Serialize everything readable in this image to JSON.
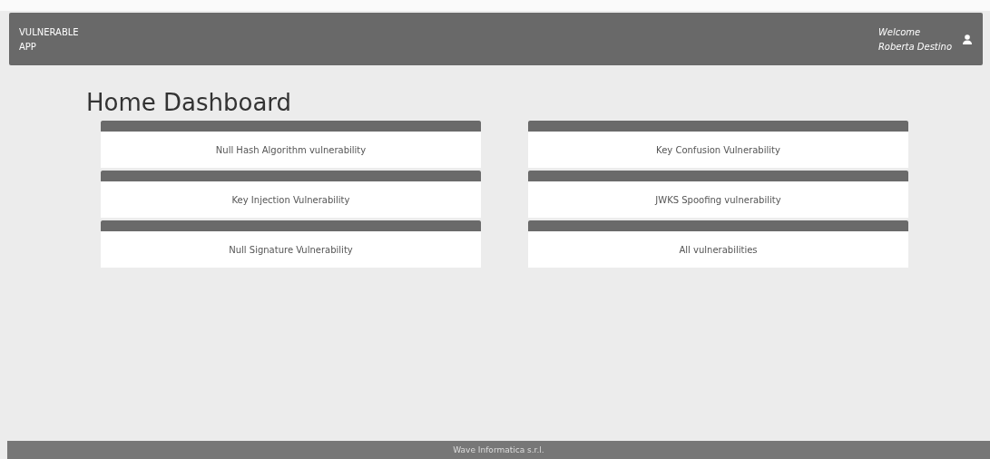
{
  "navbar": {
    "brand": [
      "VULNERABLE",
      "APP"
    ],
    "welcome": "Welcome",
    "user": "Roberta Destino"
  },
  "page_title": "Home Dashboard",
  "cards": [
    {
      "label": "Null Hash Algorithm vulnerability"
    },
    {
      "label": "Key Confusion Vulnerability"
    },
    {
      "label": "Key Injection Vulnerability"
    },
    {
      "label": "JWKS Spoofing vulnerability"
    },
    {
      "label": "Null Signature Vulnerability"
    },
    {
      "label": "All vulnerabilities"
    }
  ],
  "footer": "Wave Informatica s.r.l."
}
